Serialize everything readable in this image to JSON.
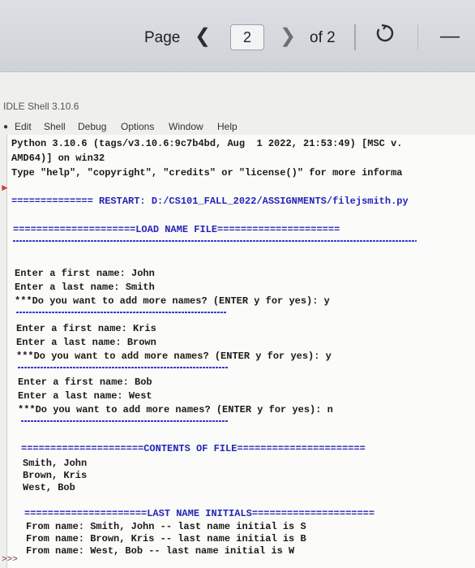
{
  "toolbar": {
    "page_label": "Page",
    "page_value": "2",
    "of_label": "of 2"
  },
  "window": {
    "title": "IDLE Shell 3.10.6",
    "menu": [
      "Edit",
      "Shell",
      "Debug",
      "Options",
      "Window",
      "Help"
    ]
  },
  "shell": {
    "header1": "Python 3.10.6 (tags/v3.10.6:9c7b4bd, Aug  1 2022, 21:53:49) [MSC v.",
    "header2": "AMD64)] on win32",
    "header3": "Type \"help\", \"copyright\", \"credits\" or \"license()\" for more informa",
    "restart_bar": "============== RESTART: D:/CS101_FALL_2022/ASSIGNMENTS/filejsmith.py",
    "load_title": "=====================LOAD NAME FILE=====================",
    "p1_first": "Enter a first name: John",
    "p1_last": "Enter a last name: Smith",
    "p1_more": "***Do you want to add more names? (ENTER y for yes): y",
    "p2_first": "Enter a first name: Kris",
    "p2_last": "Enter a last name: Brown",
    "p2_more": "***Do you want to add more names? (ENTER y for yes): y",
    "p3_first": "Enter a first name: Bob",
    "p3_last": "Enter a last name: West",
    "p3_more": "***Do you want to add more names? (ENTER y for yes): n",
    "contents_title": "=====================CONTENTS OF FILE======================",
    "c1": "Smith, John",
    "c2": "Brown, Kris",
    "c3": "West, Bob",
    "initials_title": "=====================LAST NAME INITIALS=====================",
    "i1": "From name: Smith, John -- last name initial is S",
    "i2": "From name: Brown, Kris -- last name initial is B",
    "i3": "From name: West, Bob -- last name initial is W",
    "prompt": ">>>"
  },
  "colors": {
    "prompt_text": "#1a1a1a",
    "separator_blue": "#2424b8"
  }
}
